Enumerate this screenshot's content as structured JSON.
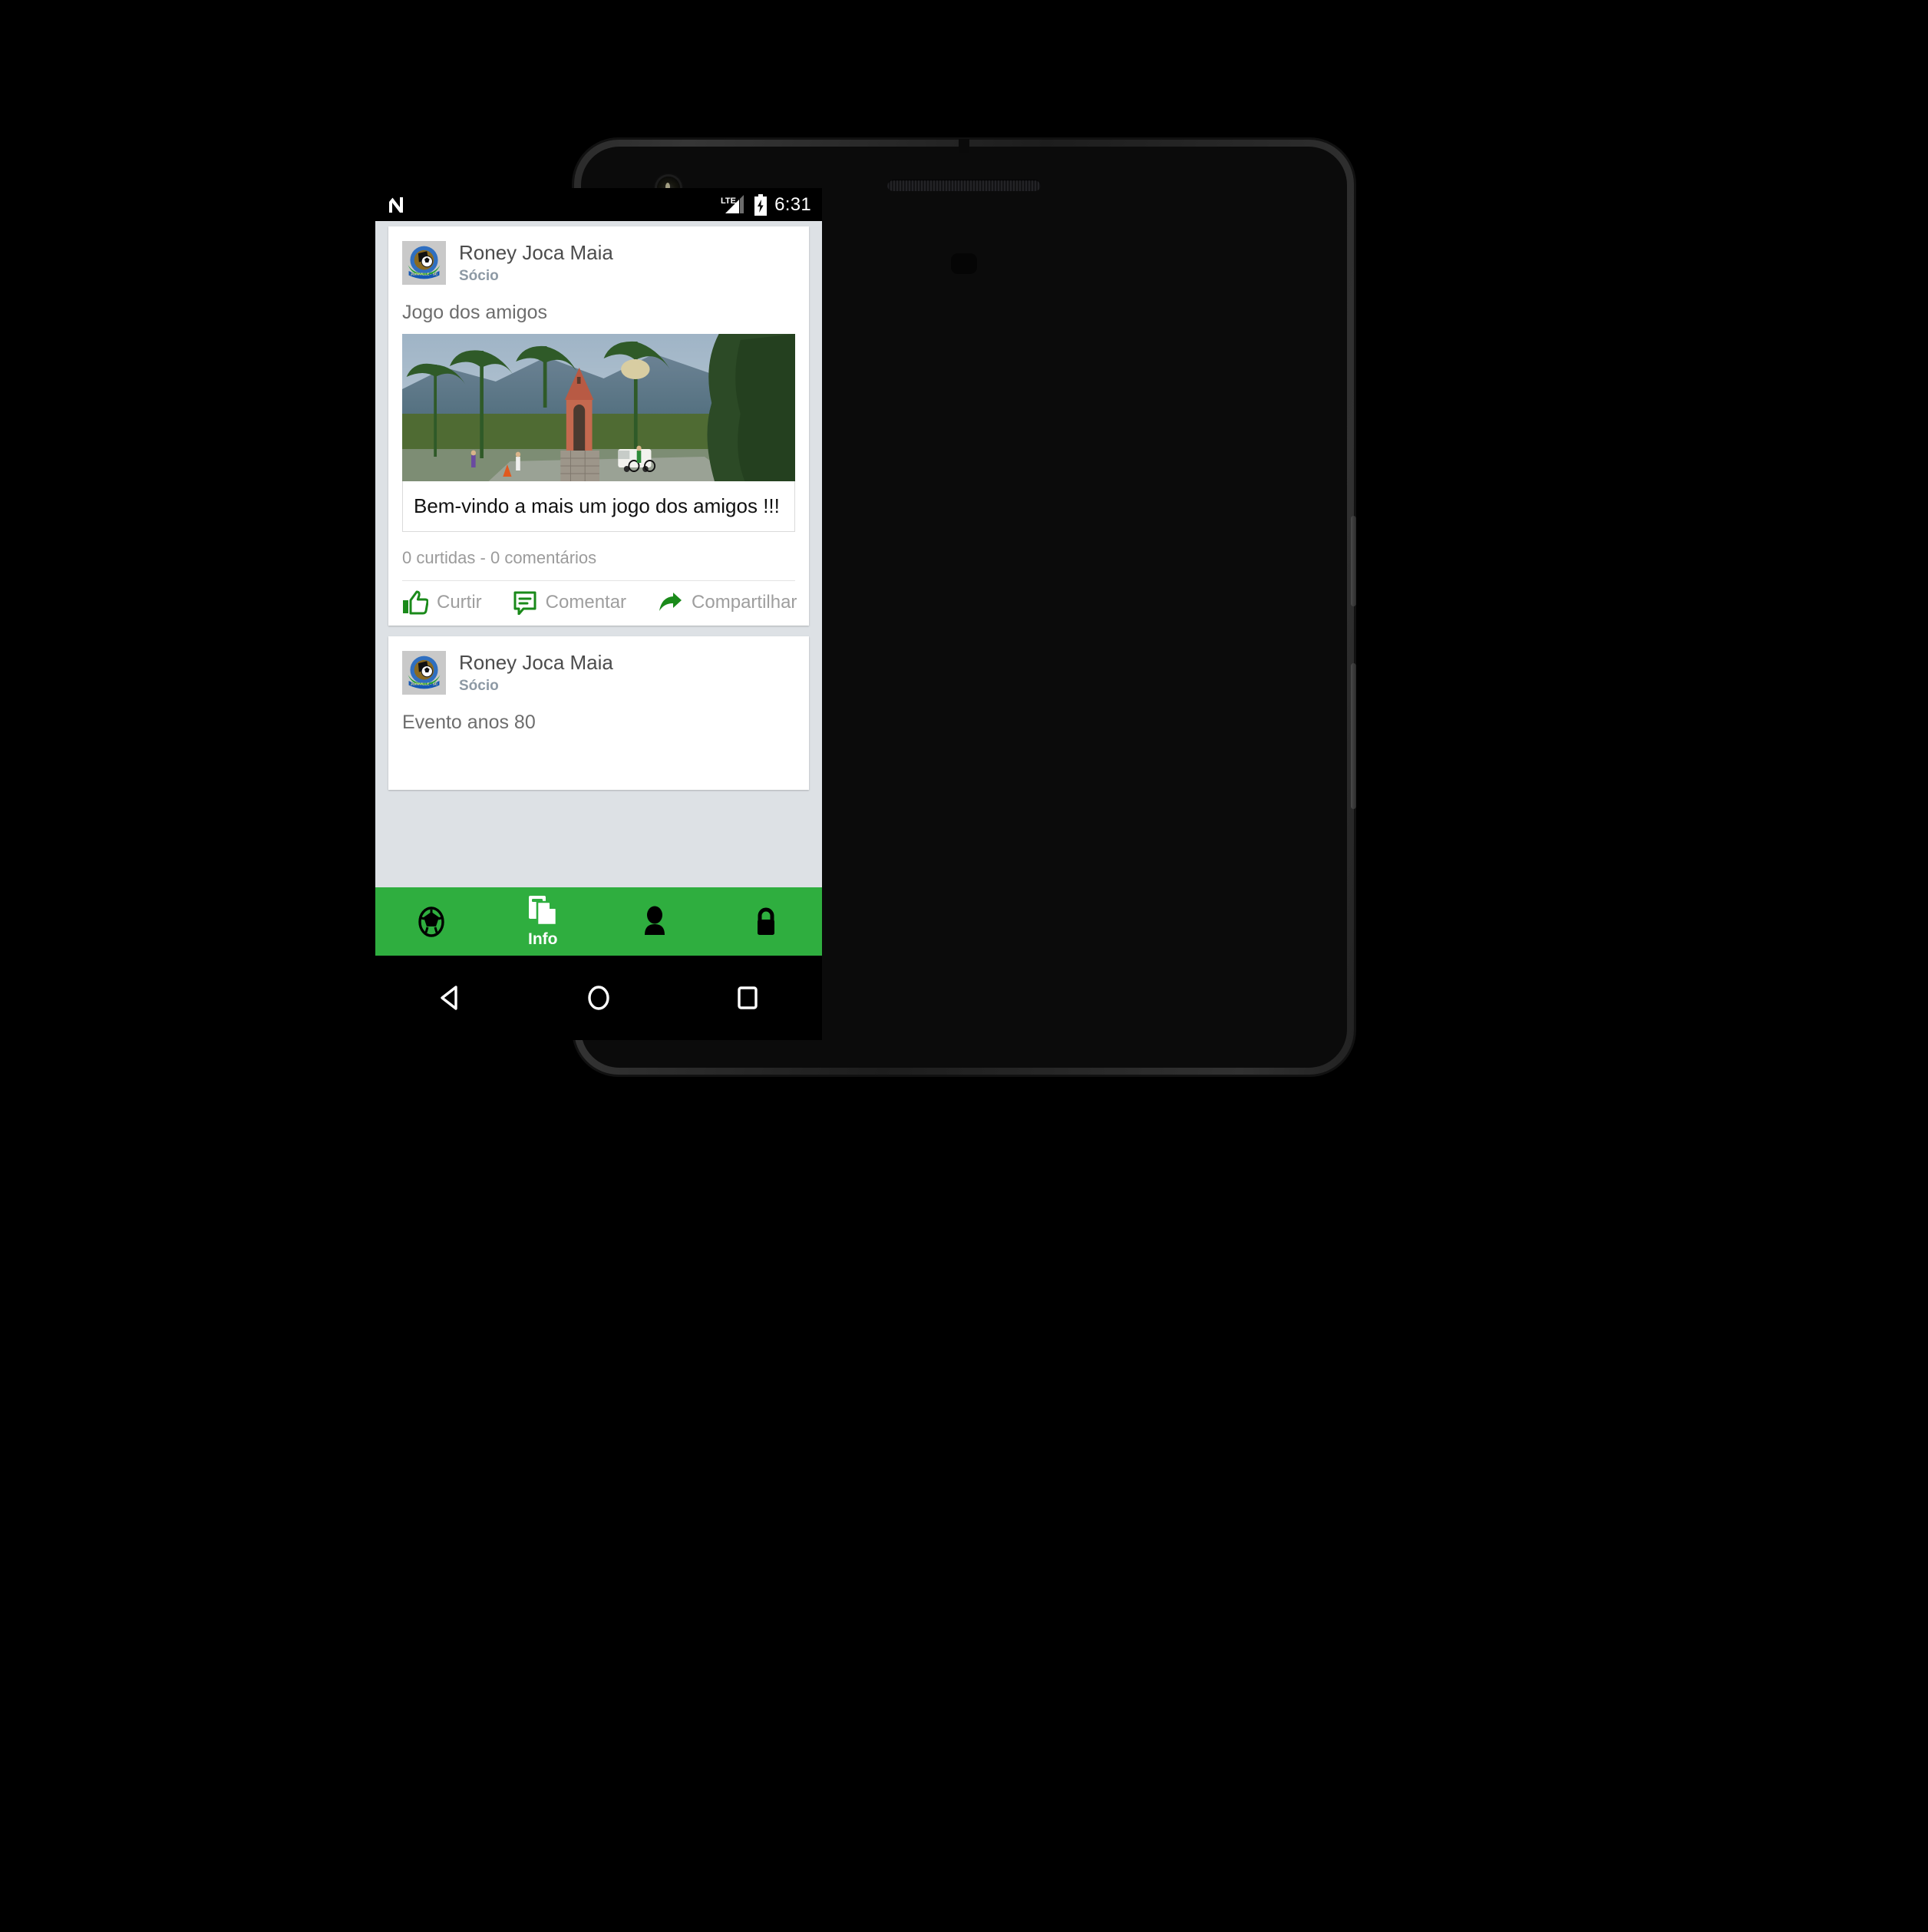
{
  "device": {
    "platform": "Android",
    "hardware": {
      "camera": "front-camera",
      "earpiece": "earpiece-speaker",
      "sensor": "proximity-sensor",
      "buttons": [
        "power-button",
        "volume-rocker"
      ]
    }
  },
  "statusbar": {
    "launcher_icon": "android-n-logo",
    "network_label": "LTE",
    "signal_icon": "signal-bars-icon",
    "battery_icon": "battery-charging-icon",
    "clock": "6:31"
  },
  "feed": {
    "posts": [
      {
        "author": "Roney Joca Maia",
        "role": "Sócio",
        "avatar_icon": "club-crest-avatar",
        "text": "Jogo dos amigos",
        "photo_alt": "red-bell-tower-photo",
        "caption": "Bem-vindo a mais um jogo dos amigos !!!",
        "likes_label": "0 curtidas",
        "separator": "-",
        "comments_label": "0 comentários",
        "actions": [
          {
            "label": "Curtir",
            "icon": "thumbs-up-icon"
          },
          {
            "label": "Comentar",
            "icon": "comment-icon"
          },
          {
            "label": "Compartilhar",
            "icon": "share-arrow-icon"
          }
        ]
      },
      {
        "author": "Roney Joca Maia",
        "role": "Sócio",
        "avatar_icon": "club-crest-avatar",
        "text": "Evento anos 80"
      }
    ]
  },
  "bottomnav": {
    "items": [
      {
        "label": "",
        "icon": "soccer-ball-icon",
        "active": false
      },
      {
        "label": "Info",
        "icon": "documents-icon",
        "active": true
      },
      {
        "label": "",
        "icon": "person-icon",
        "active": false
      },
      {
        "label": "",
        "icon": "lock-icon",
        "active": false
      }
    ]
  },
  "androidnav": {
    "back": "back-triangle-icon",
    "home": "home-circle-icon",
    "recents": "recents-square-icon"
  },
  "colors": {
    "nav_green": "#2fae3f",
    "action_green": "#1a8a1a",
    "app_background": "#dde1e5",
    "card_background": "#ffffff",
    "role_text": "#8d99a4",
    "muted_text": "#9e9e9e"
  }
}
